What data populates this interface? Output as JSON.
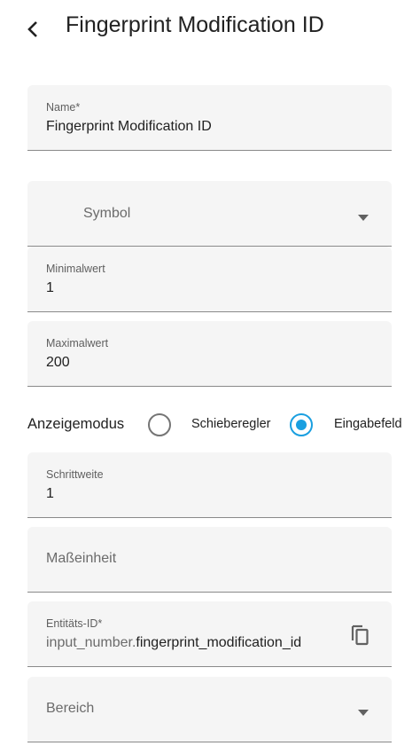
{
  "header": {
    "back_icon": "chevron-left-icon",
    "title": "Fingerprint Modification ID"
  },
  "form": {
    "name": {
      "label": "Name*",
      "value": "Fingerprint Modification ID"
    },
    "symbol": {
      "placeholder": "Symbol",
      "icon": "dropdown-arrow-icon"
    },
    "min": {
      "label": "Minimalwert",
      "value": "1"
    },
    "max": {
      "label": "Maximalwert",
      "value": "200"
    },
    "display_mode": {
      "label": "Anzeigemodus",
      "options": [
        {
          "label": "Schieberegler",
          "selected": false
        },
        {
          "label": "Eingabefeld",
          "selected": true
        }
      ]
    },
    "step": {
      "label": "Schrittweite",
      "value": "1"
    },
    "unit": {
      "placeholder": "Maßeinheit"
    },
    "entity_id": {
      "label": "Entitäts-ID*",
      "prefix": "input_number.",
      "value": "fingerprint_modification_id",
      "copy_icon": "copy-icon"
    },
    "area": {
      "placeholder": "Bereich",
      "icon": "dropdown-arrow-icon"
    }
  },
  "colors": {
    "accent": "#1a9fe0",
    "field_bg": "#f5f5f5"
  }
}
